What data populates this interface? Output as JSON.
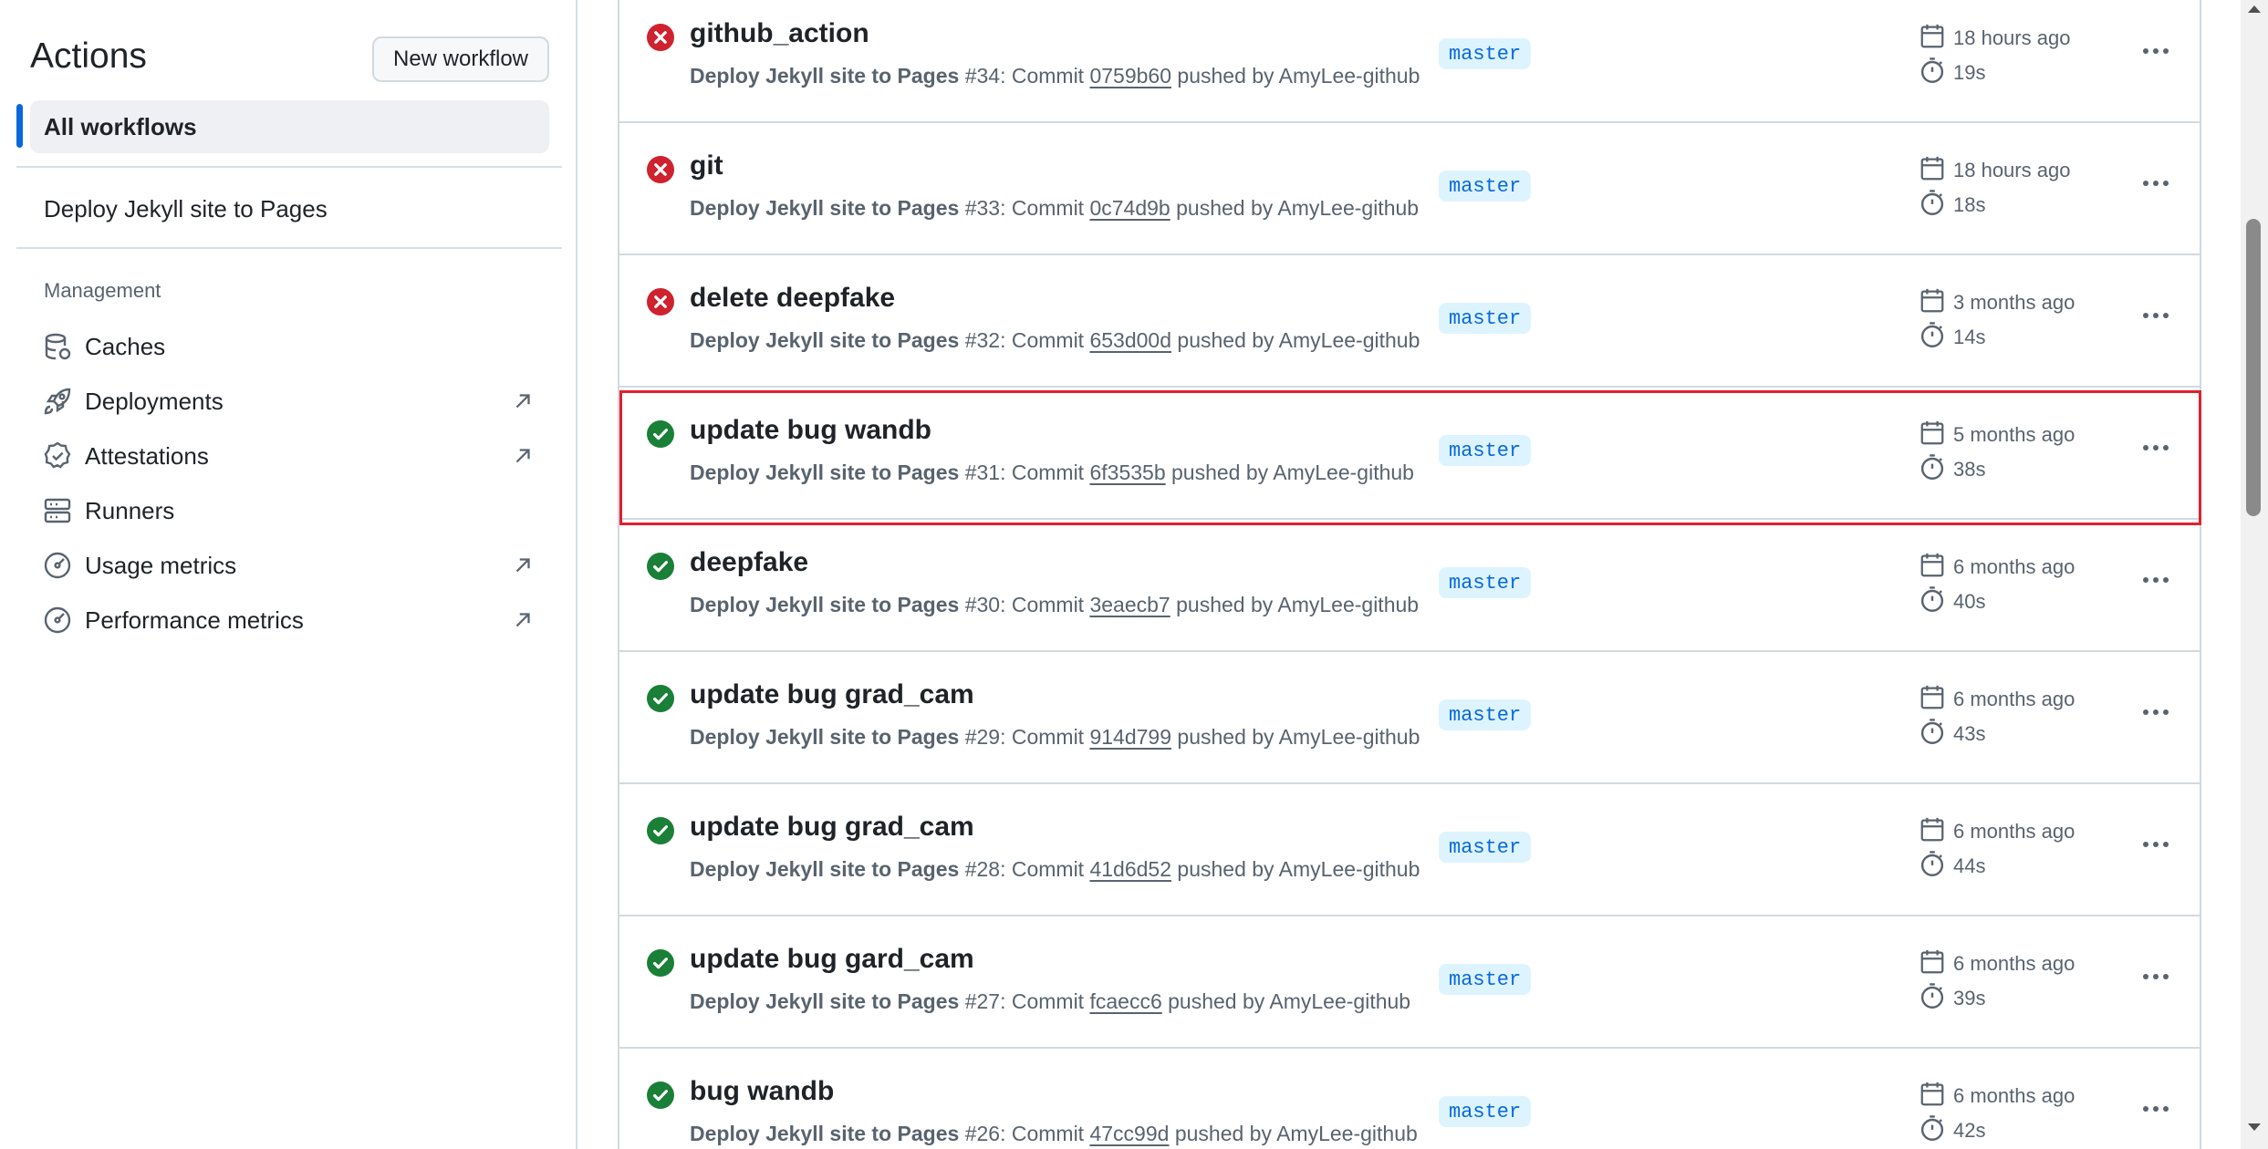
{
  "sidebar": {
    "title": "Actions",
    "new_workflow_label": "New workflow",
    "all_workflows_label": "All workflows",
    "workflow_item": "Deploy Jekyll site to Pages",
    "management_heading": "Management",
    "management_items": [
      {
        "label": "Caches",
        "icon": "database-icon",
        "external": false
      },
      {
        "label": "Deployments",
        "icon": "rocket-icon",
        "external": true
      },
      {
        "label": "Attestations",
        "icon": "verified-badge-icon",
        "external": true
      },
      {
        "label": "Runners",
        "icon": "server-icon",
        "external": false
      },
      {
        "label": "Usage metrics",
        "icon": "meter-icon",
        "external": true
      },
      {
        "label": "Performance metrics",
        "icon": "meter-icon",
        "external": true
      }
    ]
  },
  "runs": [
    {
      "title": "github_action",
      "status": "failure",
      "workflow": "Deploy Jekyll site to Pages",
      "run_number": "#34",
      "commit": "0759b60",
      "actor": "AmyLee-github",
      "branch": "master",
      "when": "18 hours ago",
      "duration": "19s"
    },
    {
      "title": "git",
      "status": "failure",
      "workflow": "Deploy Jekyll site to Pages",
      "run_number": "#33",
      "commit": "0c74d9b",
      "actor": "AmyLee-github",
      "branch": "master",
      "when": "18 hours ago",
      "duration": "18s"
    },
    {
      "title": "delete deepfake",
      "status": "failure",
      "workflow": "Deploy Jekyll site to Pages",
      "run_number": "#32",
      "commit": "653d00d",
      "actor": "AmyLee-github",
      "branch": "master",
      "when": "3 months ago",
      "duration": "14s"
    },
    {
      "title": "update bug wandb",
      "status": "success",
      "workflow": "Deploy Jekyll site to Pages",
      "run_number": "#31",
      "commit": "6f3535b",
      "actor": "AmyLee-github",
      "branch": "master",
      "when": "5 months ago",
      "duration": "38s"
    },
    {
      "title": "deepfake",
      "status": "success",
      "workflow": "Deploy Jekyll site to Pages",
      "run_number": "#30",
      "commit": "3eaecb7",
      "actor": "AmyLee-github",
      "branch": "master",
      "when": "6 months ago",
      "duration": "40s"
    },
    {
      "title": "update bug grad_cam",
      "status": "success",
      "workflow": "Deploy Jekyll site to Pages",
      "run_number": "#29",
      "commit": "914d799",
      "actor": "AmyLee-github",
      "branch": "master",
      "when": "6 months ago",
      "duration": "43s"
    },
    {
      "title": "update bug grad_cam",
      "status": "success",
      "workflow": "Deploy Jekyll site to Pages",
      "run_number": "#28",
      "commit": "41d6d52",
      "actor": "AmyLee-github",
      "branch": "master",
      "when": "6 months ago",
      "duration": "44s"
    },
    {
      "title": "update bug gard_cam",
      "status": "success",
      "workflow": "Deploy Jekyll site to Pages",
      "run_number": "#27",
      "commit": "fcaecc6",
      "actor": "AmyLee-github",
      "branch": "master",
      "when": "6 months ago",
      "duration": "39s"
    },
    {
      "title": "bug wandb",
      "status": "success",
      "workflow": "Deploy Jekyll site to Pages",
      "run_number": "#26",
      "commit": "47cc99d",
      "actor": "AmyLee-github",
      "branch": "master",
      "when": "6 months ago",
      "duration": "42s"
    }
  ],
  "highlighted_run_index": 3,
  "strings": {
    "commit_word": "Commit",
    "pushed_by": "pushed by"
  },
  "colors": {
    "failure": "#cf222e",
    "success": "#1a7f37",
    "accent": "#0969da",
    "highlight": "#e02030"
  }
}
